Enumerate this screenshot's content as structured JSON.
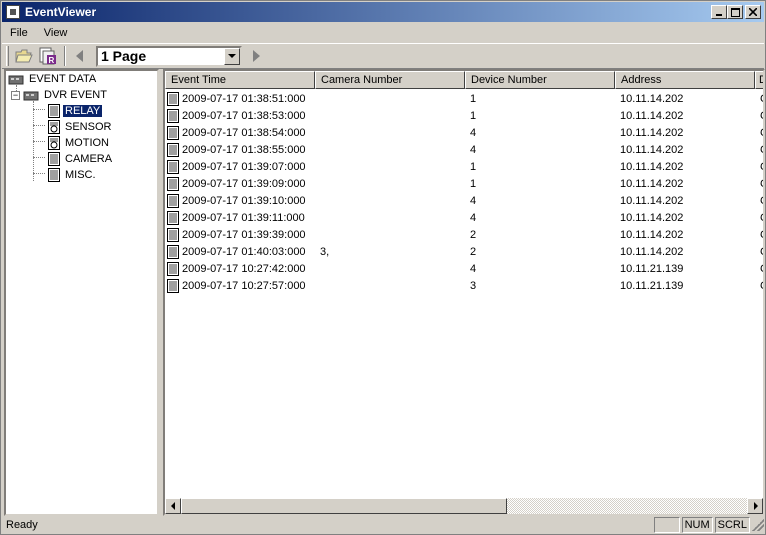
{
  "window": {
    "title": "EventViewer"
  },
  "menu": {
    "items": [
      "File",
      "View"
    ]
  },
  "toolbar": {
    "page_selector": "1 Page"
  },
  "tree": {
    "root": "EVENT DATA",
    "group": "DVR EVENT",
    "children": [
      "RELAY",
      "SENSOR",
      "MOTION",
      "CAMERA",
      "MISC."
    ],
    "selected": "RELAY"
  },
  "table": {
    "columns": [
      "Event Time",
      "Camera Number",
      "Device Number",
      "Address",
      "D"
    ],
    "rows": [
      [
        "2009-07-17 01:38:51:000",
        "",
        "1",
        "10.11.14.202",
        "C"
      ],
      [
        "2009-07-17 01:38:53:000",
        "",
        "1",
        "10.11.14.202",
        "C"
      ],
      [
        "2009-07-17 01:38:54:000",
        "",
        "4",
        "10.11.14.202",
        "C"
      ],
      [
        "2009-07-17 01:38:55:000",
        "",
        "4",
        "10.11.14.202",
        "C"
      ],
      [
        "2009-07-17 01:39:07:000",
        "",
        "1",
        "10.11.14.202",
        "C"
      ],
      [
        "2009-07-17 01:39:09:000",
        "",
        "1",
        "10.11.14.202",
        "C"
      ],
      [
        "2009-07-17 01:39:10:000",
        "",
        "4",
        "10.11.14.202",
        "C"
      ],
      [
        "2009-07-17 01:39:11:000",
        "",
        "4",
        "10.11.14.202",
        "C"
      ],
      [
        "2009-07-17 01:39:39:000",
        "",
        "2",
        "10.11.14.202",
        "C"
      ],
      [
        "2009-07-17 01:40:03:000",
        "3,",
        "2",
        "10.11.14.202",
        "C"
      ],
      [
        "2009-07-17 10:27:42:000",
        "",
        "4",
        "10.11.21.139",
        "C"
      ],
      [
        "2009-07-17 10:27:57:000",
        "",
        "3",
        "10.11.21.139",
        "C"
      ]
    ]
  },
  "status": {
    "text": "Ready",
    "num": "NUM",
    "scrl": "SCRL"
  }
}
